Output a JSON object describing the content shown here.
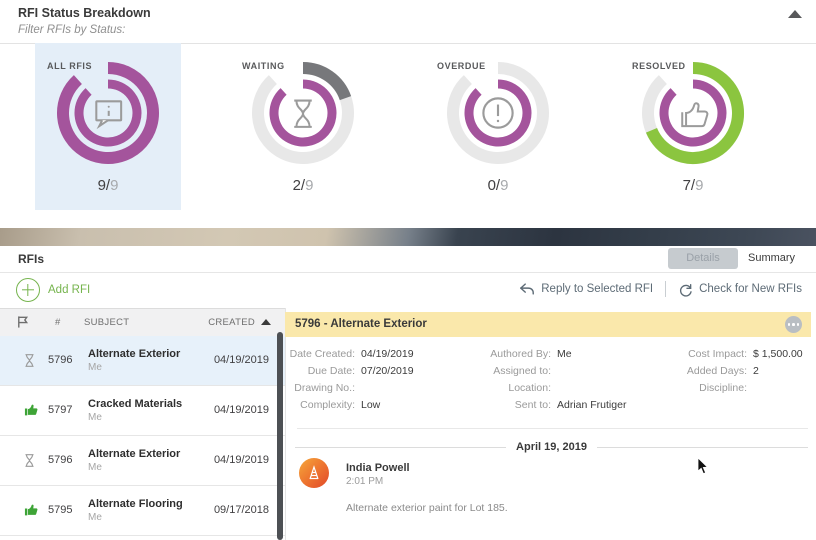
{
  "breakdown": {
    "title": "RFI Status Breakdown",
    "subtitle": "Filter RFIs by Status:",
    "collapse_icon": "caret-up-icon"
  },
  "chart_data": {
    "type": "pie",
    "subtype": "donut-status-gauges",
    "title": "RFI Status Breakdown",
    "total_rfis": 9,
    "separator": "/",
    "track_color": "#E8E8E8",
    "inner_ring_color": "#A4549C",
    "cards": [
      {
        "label": "ALL RFIS",
        "icon": "info-bubble-icon",
        "count": 9,
        "total": 9,
        "color": "#A4549C",
        "selected": true
      },
      {
        "label": "WAITING",
        "icon": "hourglass-icon",
        "count": 2,
        "total": 9,
        "color": "#77787B",
        "selected": false
      },
      {
        "label": "OVERDUE",
        "icon": "exclamation-icon",
        "count": 0,
        "total": 9,
        "color": "#E8E8E8",
        "selected": false
      },
      {
        "label": "RESOLVED",
        "icon": "thumbs-up-icon",
        "count": 7,
        "total": 9,
        "color": "#8BC53F",
        "selected": false
      }
    ]
  },
  "rfis": {
    "title": "RFIs",
    "tabs": {
      "details": "Details",
      "summary": "Summary",
      "active": "Details"
    },
    "toolbar": {
      "add_label": "Add RFI",
      "reply_label": "Reply to Selected RFI",
      "check_label": "Check for New RFIs"
    },
    "table": {
      "columns": {
        "number": "#",
        "subject": "SUBJECT",
        "created": "CREATED"
      },
      "sort": {
        "column": "CREATED",
        "direction": "asc"
      },
      "rows": [
        {
          "status_icon": "hourglass-icon",
          "number": "5796",
          "subject": "Alternate Exterior",
          "author": "Me",
          "created": "04/19/2019",
          "selected": true
        },
        {
          "status_icon": "thumbs-up-icon",
          "number": "5797",
          "subject": "Cracked Materials",
          "author": "Me",
          "created": "04/19/2019",
          "selected": false
        },
        {
          "status_icon": "hourglass-icon",
          "number": "5796",
          "subject": "Alternate Exterior",
          "author": "Me",
          "created": "04/19/2019",
          "selected": false
        },
        {
          "status_icon": "thumbs-up-icon",
          "number": "5795",
          "subject": "Alternate Flooring",
          "author": "Me",
          "created": "09/17/2018",
          "selected": false
        }
      ]
    },
    "detail": {
      "header": "5796 - Alternate Exterior",
      "menu_icon": "ellipsis-icon",
      "fields_col1": [
        {
          "label": "Date Created:",
          "value": "04/19/2019"
        },
        {
          "label": "Due Date:",
          "value": "07/20/2019"
        },
        {
          "label": "Drawing No.:",
          "value": ""
        },
        {
          "label": "Complexity:",
          "value": "Low"
        }
      ],
      "fields_col2": [
        {
          "label": "Authored By:",
          "value": "Me"
        },
        {
          "label": "Assigned to:",
          "value": ""
        },
        {
          "label": "Location:",
          "value": ""
        },
        {
          "label": "Sent to:",
          "value": "Adrian Frutiger"
        }
      ],
      "fields_col3": [
        {
          "label": "Cost Impact:",
          "value": "$ 1,500.00"
        },
        {
          "label": "Added Days:",
          "value": "2"
        },
        {
          "label": "Discipline:",
          "value": ""
        }
      ],
      "date_divider": "April 19, 2019",
      "comment": {
        "author": "India Powell",
        "time": "2:01 PM",
        "text": "Alternate exterior paint for Lot 185."
      }
    }
  }
}
